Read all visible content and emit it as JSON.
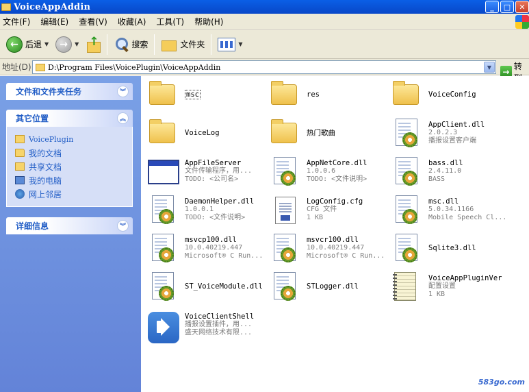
{
  "window": {
    "title": "VoiceAppAddin",
    "min": "_",
    "max": "□",
    "close": "✕"
  },
  "menu": [
    "文件(F)",
    "编辑(E)",
    "查看(V)",
    "收藏(A)",
    "工具(T)",
    "帮助(H)"
  ],
  "toolbar": {
    "back_label": "后退",
    "search_label": "搜索",
    "folders_label": "文件夹"
  },
  "address": {
    "label": "地址(D)",
    "path": "D:\\Program Files\\VoicePlugin\\VoiceAppAddin",
    "go_label": "转到"
  },
  "left": {
    "tasks_title": "文件和文件夹任务",
    "places_title": "其它位置",
    "places": [
      {
        "label": "VoicePlugin",
        "icon": "folder-icon"
      },
      {
        "label": "我的文档",
        "icon": "my-documents-icon"
      },
      {
        "label": "共享文档",
        "icon": "folder-icon"
      },
      {
        "label": "我的电脑",
        "icon": "my-computer-icon"
      },
      {
        "label": "网上邻居",
        "icon": "network-icon"
      }
    ],
    "details_title": "详细信息"
  },
  "files": [
    {
      "name": "msc",
      "type": "folder",
      "lines": []
    },
    {
      "name": "res",
      "type": "folder",
      "lines": []
    },
    {
      "name": "VoiceConfig",
      "type": "folder",
      "lines": []
    },
    {
      "name": "VoiceLog",
      "type": "folder",
      "lines": []
    },
    {
      "name": "热门歌曲",
      "type": "folder",
      "lines": []
    },
    {
      "name": "AppClient.dll",
      "type": "dll",
      "lines": [
        "2.0.2.3",
        "播报设置客户端"
      ]
    },
    {
      "name": "AppFileServer",
      "type": "exe",
      "lines": [
        "文件传输程序，用...",
        "TODO: <公司名>"
      ]
    },
    {
      "name": "AppNetCore.dll",
      "type": "dll",
      "lines": [
        "1.0.0.6",
        "TODO: <文件说明>"
      ]
    },
    {
      "name": "bass.dll",
      "type": "dll",
      "lines": [
        "2.4.11.0",
        "BASS"
      ]
    },
    {
      "name": "DaemonHelper.dll",
      "type": "dll",
      "lines": [
        "1.0.0.1",
        "TODO: <文件说明>"
      ]
    },
    {
      "name": "LogConfig.cfg",
      "type": "cfg",
      "lines": [
        "CFG 文件",
        "1 KB"
      ]
    },
    {
      "name": "msc.dll",
      "type": "dll",
      "lines": [
        "5.0.34.1166",
        "Mobile Speech Cl..."
      ]
    },
    {
      "name": "msvcp100.dll",
      "type": "dll",
      "lines": [
        "10.0.40219.447",
        "Microsoft® C Run..."
      ]
    },
    {
      "name": "msvcr100.dll",
      "type": "dll",
      "lines": [
        "10.0.40219.447",
        "Microsoft® C Run..."
      ]
    },
    {
      "name": "Sqlite3.dll",
      "type": "dll",
      "lines": []
    },
    {
      "name": "ST_VoiceModule.dll",
      "type": "dll",
      "lines": []
    },
    {
      "name": "STLogger.dll",
      "type": "dll",
      "lines": []
    },
    {
      "name": "VoiceAppPluginVer",
      "type": "notebook",
      "lines": [
        "配置设置",
        "1 KB"
      ]
    },
    {
      "name": "VoiceClientShell",
      "type": "speaker",
      "lines": [
        "播报设置插件，用...",
        "盛天网络技术有限..."
      ]
    }
  ],
  "watermark": "583go.com"
}
